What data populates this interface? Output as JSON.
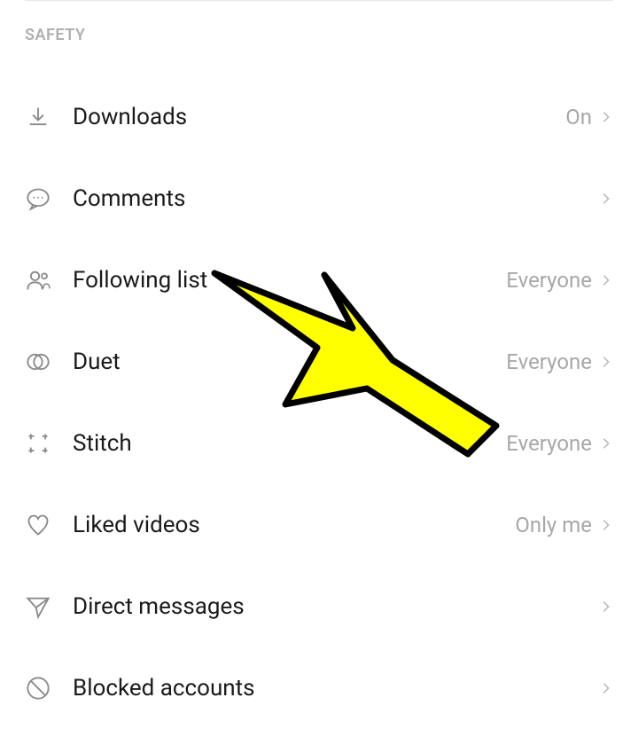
{
  "section_header": "SAFETY",
  "settings": {
    "downloads": {
      "label": "Downloads",
      "value": "On"
    },
    "comments": {
      "label": "Comments",
      "value": ""
    },
    "following_list": {
      "label": "Following list",
      "value": "Everyone"
    },
    "duet": {
      "label": "Duet",
      "value": "Everyone"
    },
    "stitch": {
      "label": "Stitch",
      "value": "Everyone"
    },
    "liked_videos": {
      "label": "Liked videos",
      "value": "Only me"
    },
    "direct_messages": {
      "label": "Direct messages",
      "value": ""
    },
    "blocked_accounts": {
      "label": "Blocked accounts",
      "value": ""
    }
  },
  "annotation": {
    "type": "arrow",
    "target": "following-list-row",
    "color": "#FFFF00"
  }
}
